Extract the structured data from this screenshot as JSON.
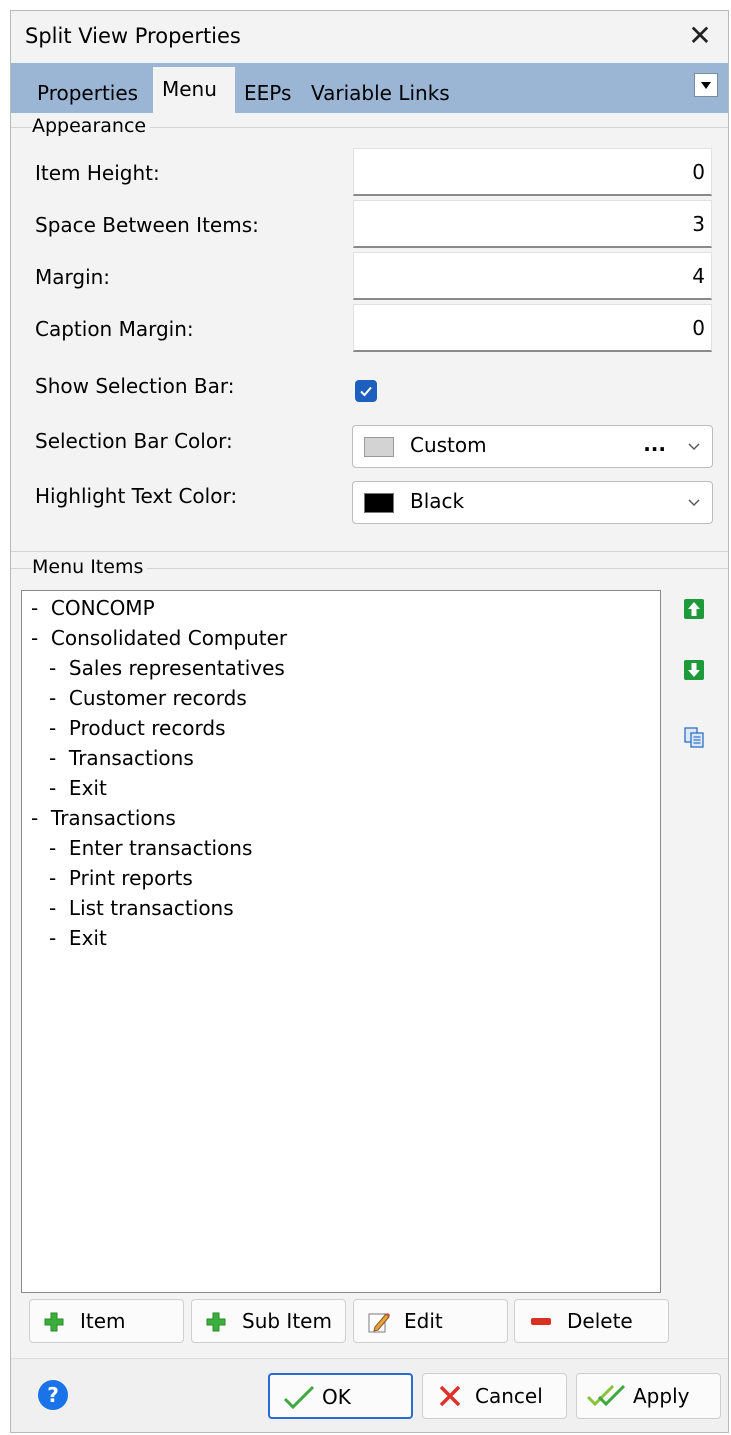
{
  "window": {
    "title": "Split View Properties"
  },
  "tabs": [
    {
      "label": "Properties"
    },
    {
      "label": "Menu"
    },
    {
      "label": "EEPs"
    },
    {
      "label": "Variable Links"
    }
  ],
  "active_tab": "Menu",
  "appearance": {
    "group_label": "Appearance",
    "item_height": {
      "label": "Item Height:",
      "value": "0"
    },
    "space_between_items": {
      "label": "Space Between Items:",
      "value": "3"
    },
    "margin": {
      "label": "Margin:",
      "value": "4"
    },
    "caption_margin": {
      "label": "Caption Margin:",
      "value": "0"
    },
    "show_selection_bar": {
      "label": "Show Selection Bar:",
      "checked": true
    },
    "selection_bar_color": {
      "label": "Selection Bar Color:",
      "value": "Custom",
      "swatch": "#d3d3d3",
      "ellipsis": "..."
    },
    "highlight_text_color": {
      "label": "Highlight Text Color:",
      "value": "Black",
      "swatch": "#000000"
    }
  },
  "menu_items": {
    "group_label": "Menu Items",
    "items": [
      {
        "text": "-  CONCOMP",
        "level": 0
      },
      {
        "text": "-  Consolidated Computer",
        "level": 0
      },
      {
        "text": "-  Sales representatives",
        "level": 1
      },
      {
        "text": "-  Customer records",
        "level": 1
      },
      {
        "text": "-  Product records",
        "level": 1
      },
      {
        "text": "-  Transactions",
        "level": 1
      },
      {
        "text": "-  Exit",
        "level": 1
      },
      {
        "text": "-  Transactions",
        "level": 0
      },
      {
        "text": "-  Enter transactions",
        "level": 1
      },
      {
        "text": "-  Print reports",
        "level": 1
      },
      {
        "text": "-  List transactions",
        "level": 1
      },
      {
        "text": "-  Exit",
        "level": 1
      }
    ]
  },
  "buttons": {
    "item": "Item",
    "sub_item": "Sub Item",
    "edit": "Edit",
    "delete": "Delete"
  },
  "footer": {
    "help": "?",
    "ok": "OK",
    "cancel": "Cancel",
    "apply": "Apply"
  },
  "colors": {
    "tab_bar": "#9bb5d5",
    "accent": "#1d5fbf",
    "arrow_green": "#1f9a3a",
    "plus_green": "#3cae3c",
    "delete_red": "#d93025"
  }
}
